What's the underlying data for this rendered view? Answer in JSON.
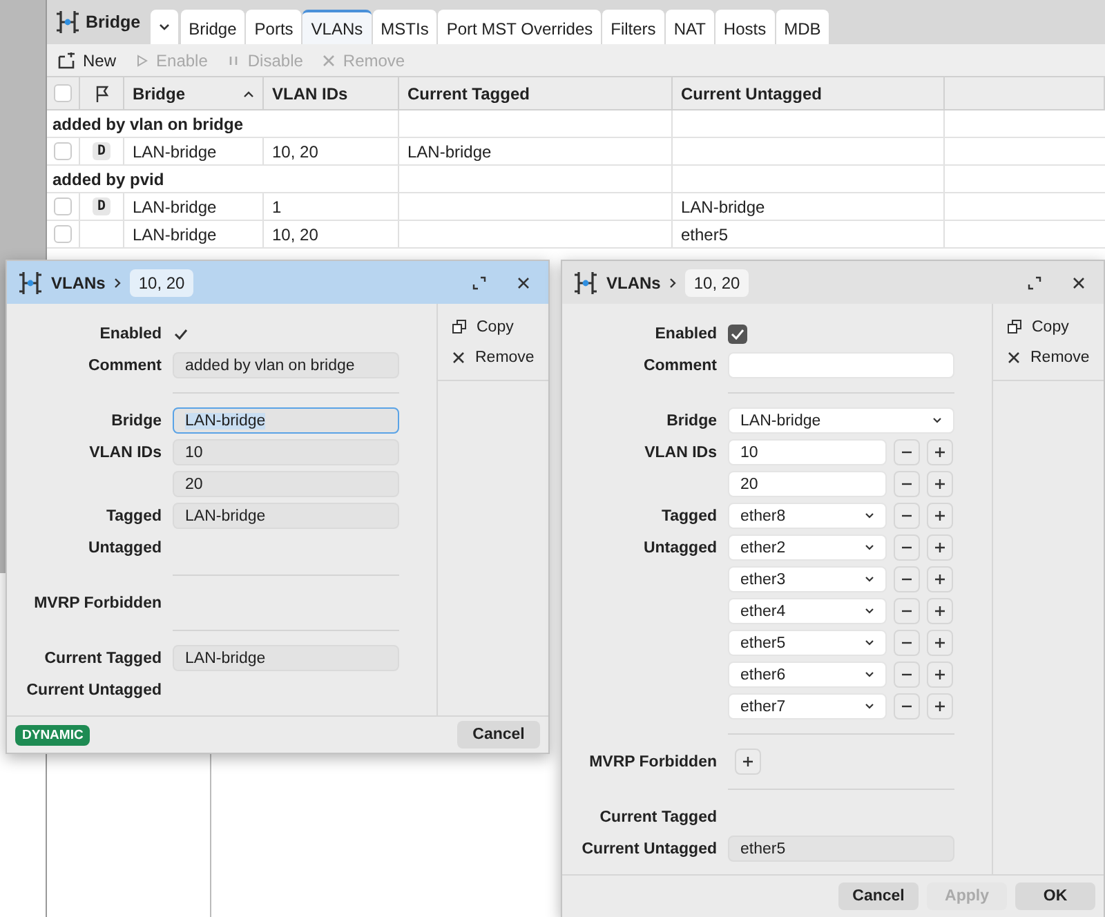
{
  "main": {
    "title": "Bridge",
    "tabs": [
      {
        "label": "Bridge",
        "selected": false
      },
      {
        "label": "Ports",
        "selected": false
      },
      {
        "label": "VLANs",
        "selected": true
      },
      {
        "label": "MSTIs",
        "selected": false
      },
      {
        "label": "Port MST Overrides",
        "selected": false
      },
      {
        "label": "Filters",
        "selected": false
      },
      {
        "label": "NAT",
        "selected": false
      },
      {
        "label": "Hosts",
        "selected": false
      },
      {
        "label": "MDB",
        "selected": false
      }
    ],
    "toolbar": [
      {
        "kind": "new",
        "label": "New",
        "disabled": false
      },
      {
        "kind": "enable",
        "label": "Enable",
        "disabled": true
      },
      {
        "kind": "disable",
        "label": "Disable",
        "disabled": true
      },
      {
        "kind": "remove",
        "label": "Remove",
        "disabled": true
      }
    ],
    "table": {
      "all_checked": false,
      "columns": [
        {
          "label": "Bridge",
          "sorted": true
        },
        {
          "label": "VLAN IDs",
          "sorted": false
        },
        {
          "label": "Current Tagged",
          "sorted": false
        },
        {
          "label": "Current Untagged",
          "sorted": false
        }
      ],
      "groups": [
        {
          "title": "added by vlan on bridge",
          "rows": [
            {
              "checked": false,
              "flag": "D",
              "cells": [
                "LAN-bridge",
                "10, 20",
                "LAN-bridge",
                ""
              ]
            }
          ]
        },
        {
          "title": "added by pvid",
          "rows": [
            {
              "checked": false,
              "flag": "D",
              "cells": [
                "LAN-bridge",
                "1",
                "",
                "LAN-bridge"
              ]
            },
            {
              "checked": false,
              "cells": [
                "LAN-bridge",
                "10, 20",
                "",
                "ether5"
              ]
            }
          ]
        }
      ]
    }
  },
  "dialogs": [
    {
      "title": "VLANs",
      "chip": "10, 20",
      "active": true,
      "editable": false,
      "actions": [
        {
          "kind": "copy",
          "label": "Copy"
        },
        {
          "kind": "remove",
          "label": "Remove"
        }
      ],
      "form": [
        {
          "kind": "checkbox",
          "label": "Enabled",
          "checked": true
        },
        {
          "kind": "text",
          "label": "Comment",
          "values": [
            "added by vlan on bridge"
          ]
        },
        {
          "kind": "divider"
        },
        {
          "kind": "text",
          "label": "Bridge",
          "values": [
            "LAN-bridge"
          ],
          "focused": true
        },
        {
          "kind": "text",
          "label": "VLAN IDs",
          "values": [
            "10",
            "20"
          ]
        },
        {
          "kind": "text",
          "label": "Tagged",
          "values": [
            "LAN-bridge"
          ]
        },
        {
          "kind": "label",
          "label": "Untagged"
        },
        {
          "kind": "divider"
        },
        {
          "kind": "label",
          "label": "MVRP Forbidden"
        },
        {
          "kind": "divider"
        },
        {
          "kind": "text",
          "label": "Current Tagged",
          "values": [
            "LAN-bridge"
          ]
        },
        {
          "kind": "label",
          "label": "Current Untagged"
        }
      ],
      "badge": "DYNAMIC",
      "buttons": [
        {
          "label": "Cancel",
          "disabled": false
        }
      ]
    },
    {
      "title": "VLANs",
      "chip": "10, 20",
      "active": false,
      "editable": true,
      "actions": [
        {
          "kind": "copy",
          "label": "Copy"
        },
        {
          "kind": "remove",
          "label": "Remove"
        }
      ],
      "form": [
        {
          "kind": "checkbox",
          "label": "Enabled",
          "checked": true
        },
        {
          "kind": "input",
          "label": "Comment"
        },
        {
          "kind": "divider"
        },
        {
          "kind": "select",
          "label": "Bridge",
          "values": [
            "LAN-bridge"
          ]
        },
        {
          "kind": "input",
          "label": "VLAN IDs",
          "values": [
            "10",
            "20"
          ],
          "stepper": true
        },
        {
          "kind": "select",
          "label": "Tagged",
          "values": [
            "ether8"
          ],
          "stepper": true
        },
        {
          "kind": "select",
          "label": "Untagged",
          "values": [
            "ether2",
            "ether3",
            "ether4",
            "ether5",
            "ether6",
            "ether7"
          ],
          "stepper": true
        },
        {
          "kind": "divider"
        },
        {
          "kind": "add",
          "label": "MVRP Forbidden"
        },
        {
          "kind": "divider"
        },
        {
          "kind": "label",
          "label": "Current Tagged"
        },
        {
          "kind": "text",
          "label": "Current Untagged",
          "values": [
            "ether5"
          ]
        }
      ],
      "buttons": [
        {
          "label": "Cancel",
          "disabled": false
        },
        {
          "label": "Apply",
          "disabled": true
        },
        {
          "label": "OK",
          "disabled": false
        }
      ]
    }
  ]
}
